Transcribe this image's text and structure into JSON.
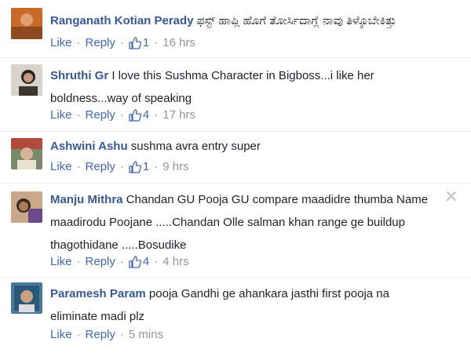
{
  "ui": {
    "like_label": "Like",
    "reply_label": "Reply",
    "separator": "·"
  },
  "comments": [
    {
      "author": "Ranganath Kotian Perady",
      "text": "ಫಸ್ಟ್ ಹಾಪ್ಲಿ ಹೊಗೆ ತೋರ್ಸಿದಾಗ್ಲೆ ನಾವು ತಿಳ್ಕೊಬೇಕಿತ್ತು",
      "likes": "1",
      "time": "16 hrs"
    },
    {
      "author": "Shruthi Gr",
      "text": "I love this Sushma Character in Bigboss...i like her boldness...way of speaking",
      "likes": "4",
      "time": "17 hrs"
    },
    {
      "author": "Ashwini Ashu",
      "text": "sushma avra entry super",
      "likes": "1",
      "time": "9 hrs"
    },
    {
      "author": "Manju Mithra",
      "text": "Chandan GU Pooja GU compare maadidre thumba Name maadirodu Poojane .....Chandan Olle salman khan range ge buildup thagothidane .....Bosudike",
      "likes": "4",
      "time": "4 hrs"
    },
    {
      "author": "Paramesh Param",
      "text": "pooja Gandhi ge ahankara jasthi first pooja na eliminate madi plz",
      "likes": "",
      "time": "5 mins"
    }
  ],
  "colors": {
    "author": "#365899",
    "link": "#4267b2",
    "meta": "#90949c",
    "text": "#1d2129"
  }
}
